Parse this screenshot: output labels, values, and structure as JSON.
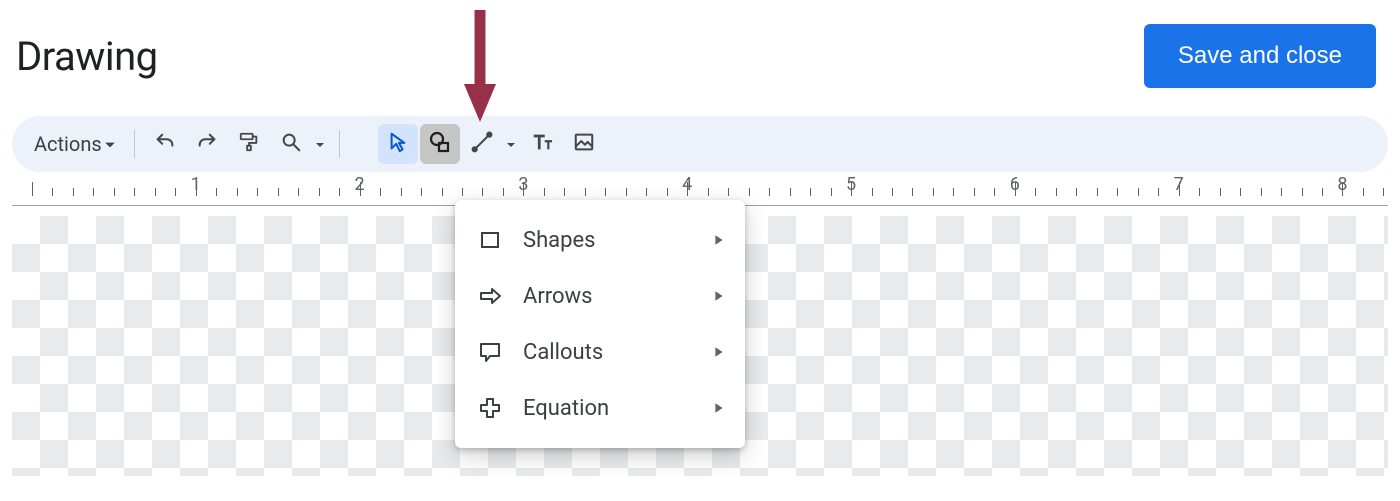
{
  "header": {
    "title": "Drawing",
    "save_label": "Save and close"
  },
  "annotation": {
    "color": "#99304a"
  },
  "toolbar": {
    "actions_label": "Actions",
    "buttons": {
      "undo": "undo",
      "redo": "redo",
      "paint_format": "paint-format",
      "zoom": "zoom",
      "select": "select",
      "shape": "shape",
      "line": "line",
      "text": "text-box",
      "image": "image"
    }
  },
  "ruler": {
    "labels": [
      "1",
      "2",
      "3",
      "4",
      "5",
      "6",
      "7",
      "8"
    ]
  },
  "menu": {
    "items": [
      {
        "icon": "shapes",
        "label": "Shapes"
      },
      {
        "icon": "arrows",
        "label": "Arrows"
      },
      {
        "icon": "callouts",
        "label": "Callouts"
      },
      {
        "icon": "equation",
        "label": "Equation"
      }
    ]
  },
  "colors": {
    "primary": "#1a73e8",
    "toolbar_bg": "#edf2fa"
  }
}
